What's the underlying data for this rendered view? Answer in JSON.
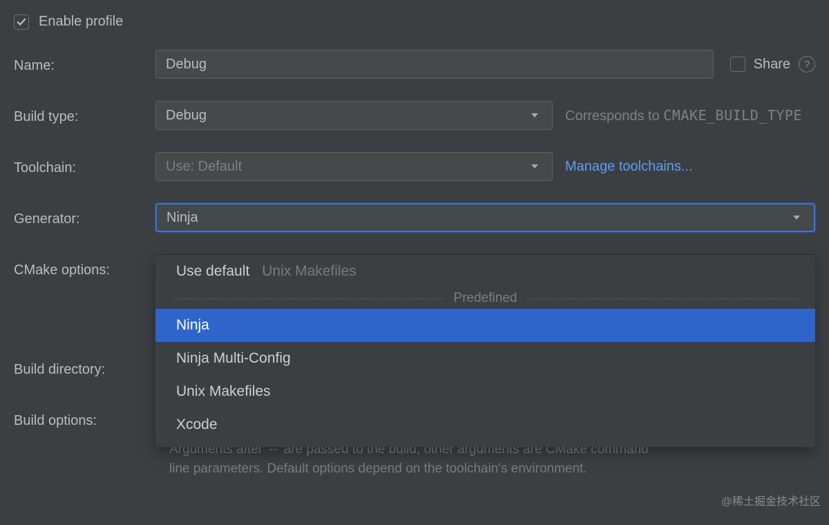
{
  "enable_profile": {
    "label": "Enable profile",
    "checked": true
  },
  "labels": {
    "name": "Name:",
    "build_type": "Build type:",
    "toolchain": "Toolchain:",
    "generator": "Generator:",
    "cmake_options": "CMake options:",
    "build_directory": "Build directory:",
    "build_options": "Build options:"
  },
  "name": {
    "value": "Debug"
  },
  "share": {
    "label": "Share",
    "checked": false
  },
  "build_type": {
    "selected": "Debug",
    "hint_prefix": "Corresponds to ",
    "hint_mono": "CMAKE_BUILD_TYPE"
  },
  "toolchain": {
    "selected": "Use: Default",
    "manage_link": "Manage toolchains..."
  },
  "generator": {
    "selected": "Ninja",
    "dropdown": {
      "default_option": {
        "label": "Use default",
        "aux": "Unix Makefiles"
      },
      "divider": "Predefined",
      "items": [
        {
          "label": "Ninja",
          "selected": true
        },
        {
          "label": "Ninja Multi-Config",
          "selected": false
        },
        {
          "label": "Unix Makefiles",
          "selected": false
        },
        {
          "label": "Xcode",
          "selected": false
        }
      ]
    }
  },
  "build_options_helper": "Arguments after '--' are passed to the build, other arguments are CMake command line parameters. Default options depend on the toolchain's environment.",
  "watermark": "@稀土掘金技术社区"
}
